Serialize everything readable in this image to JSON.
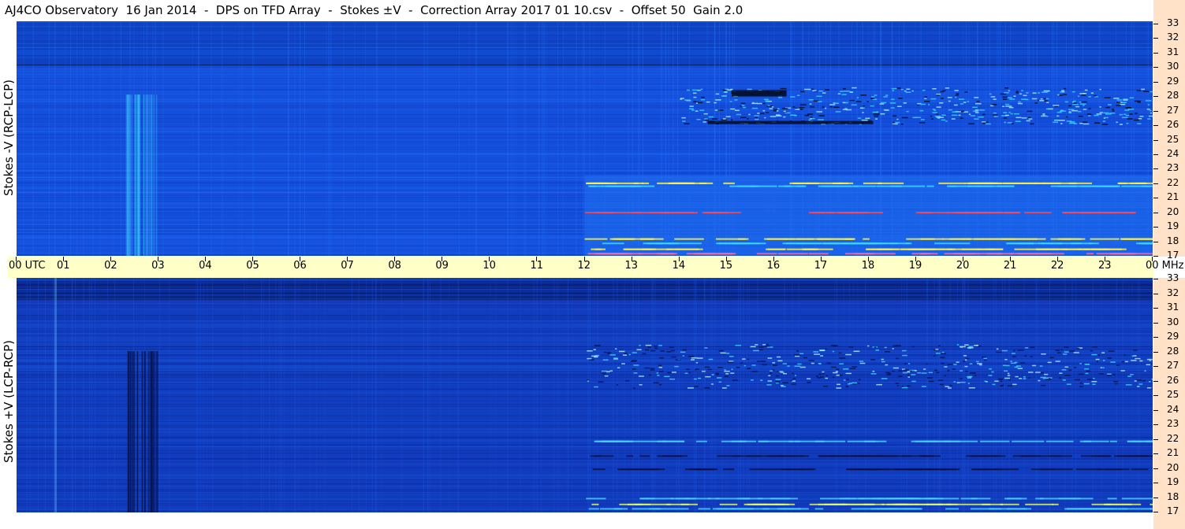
{
  "title": "AJ4CO Observatory  16 Jan 2014  -  DPS on TFD Array  -  Stokes ±V  -  Correction Array 2017 01 10.csv  -  Offset 50  Gain 2.0",
  "chart_data": [
    {
      "type": "heatmap",
      "panel": "top",
      "ylabel": "Stokes -V (RCP-LCP)",
      "x_ticks": [
        "00 UTC",
        "01",
        "02",
        "03",
        "04",
        "05",
        "06",
        "07",
        "08",
        "09",
        "10",
        "11",
        "12",
        "13",
        "14",
        "15",
        "16",
        "17",
        "18",
        "19",
        "20",
        "21",
        "22",
        "23",
        "00 MHz"
      ],
      "xlim": [
        0,
        24
      ],
      "y_ticks": [
        33,
        32,
        31,
        30,
        29,
        28,
        27,
        26,
        25,
        24,
        23,
        22,
        21,
        20,
        19,
        18,
        17
      ],
      "ylim": [
        17,
        33
      ],
      "colors": {
        "background": "#1450dc",
        "hot": "#fff03c",
        "cyan": "#3cd2ff",
        "red": "#ff4650"
      }
    },
    {
      "type": "heatmap",
      "panel": "bottom",
      "ylabel": "Stokes +V (LCP-RCP)",
      "x_ticks": [
        "00 UTC",
        "01",
        "02",
        "03",
        "04",
        "05",
        "06",
        "07",
        "08",
        "09",
        "10",
        "11",
        "12",
        "13",
        "14",
        "15",
        "16",
        "17",
        "18",
        "19",
        "20",
        "21",
        "22",
        "23",
        "00 MHz"
      ],
      "xlim": [
        0,
        24
      ],
      "y_ticks": [
        33,
        32,
        31,
        30,
        29,
        28,
        27,
        26,
        25,
        24,
        23,
        22,
        21,
        20,
        19,
        18,
        17
      ],
      "ylim": [
        17,
        33
      ],
      "colors": {
        "background": "#123cbe",
        "dark": "#06124a",
        "cyan": "#46d2ff"
      }
    }
  ]
}
